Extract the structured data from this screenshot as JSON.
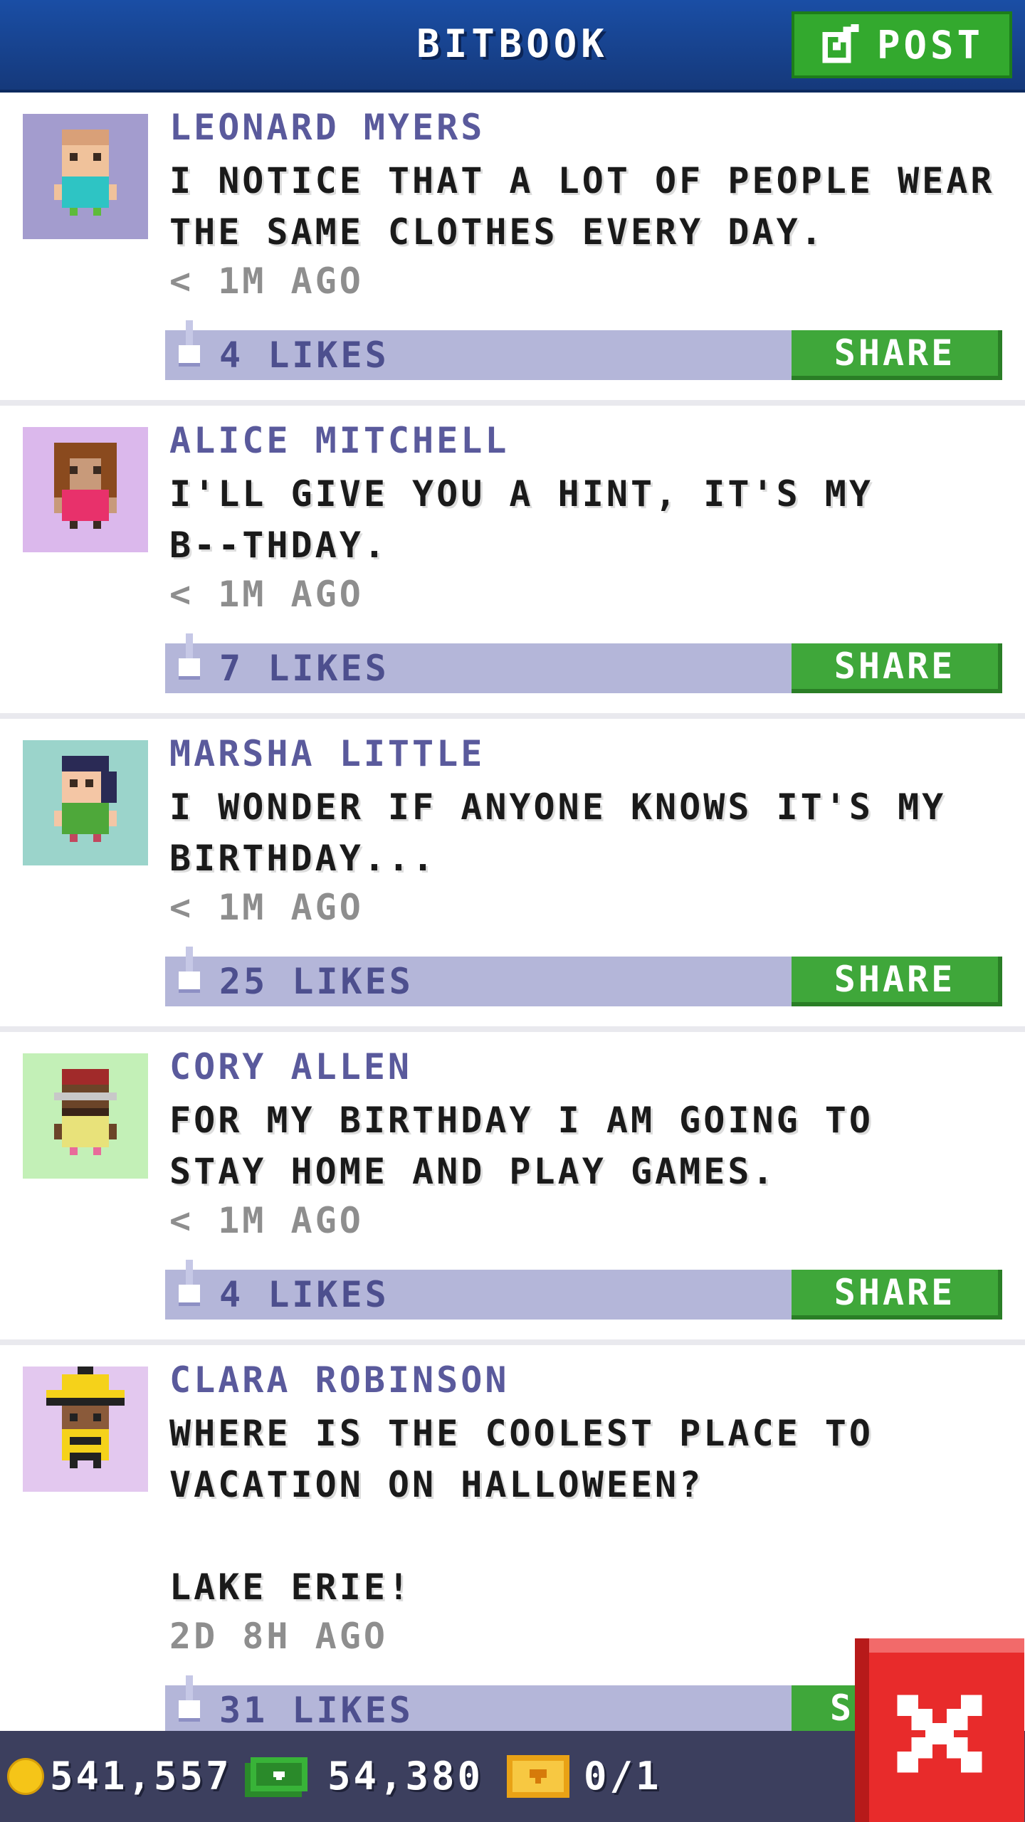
{
  "header": {
    "title": "BITBOOK",
    "post_label": "POST"
  },
  "posts": [
    {
      "author": "LEONARD MYERS",
      "message": "I NOTICE THAT A LOT OF PEOPLE WEAR\nTHE SAME CLOTHES EVERY DAY.",
      "time": "< 1M AGO",
      "likes": "4 LIKES",
      "share_label": "SHARE",
      "avatar_bg": "#a39cce",
      "avatar_name": "boy-blue-shirt-avatar"
    },
    {
      "author": "ALICE MITCHELL",
      "message": "I'LL GIVE YOU A HINT, IT'S MY\nB--THDAY.",
      "time": "< 1M AGO",
      "likes": "7 LIKES",
      "share_label": "SHARE",
      "avatar_bg": "#dbb8ec",
      "avatar_name": "girl-pink-shirt-avatar"
    },
    {
      "author": "MARSHA LITTLE",
      "message": "I WONDER IF ANYONE KNOWS IT'S MY\nBIRTHDAY...",
      "time": "< 1M AGO",
      "likes": "25 LIKES",
      "share_label": "SHARE",
      "avatar_bg": "#9bd4cb",
      "avatar_name": "girl-green-shirt-avatar"
    },
    {
      "author": "CORY ALLEN",
      "message": "FOR MY BIRTHDAY I AM GOING TO\nSTAY HOME AND PLAY GAMES.",
      "time": "< 1M AGO",
      "likes": "4 LIKES",
      "share_label": "SHARE",
      "avatar_bg": "#c3f0b7",
      "avatar_name": "man-glasses-avatar"
    },
    {
      "author": "CLARA ROBINSON",
      "message": "WHERE IS THE COOLEST PLACE TO\nVACATION ON HALLOWEEN?\n\nLAKE ERIE!",
      "time": "2D 8H AGO",
      "likes": "31 LIKES",
      "share_label": "S",
      "avatar_bg": "#e3c8ef",
      "avatar_name": "woman-yellow-hat-avatar"
    }
  ],
  "footer": {
    "coins": "541,557",
    "bux": "54,380",
    "tickets": "0/1"
  },
  "colors": {
    "header_blue": "#1a4ea5",
    "share_green": "#3fa73a",
    "likes_bar": "#b4b6d9",
    "close_red": "#e82b2b"
  }
}
